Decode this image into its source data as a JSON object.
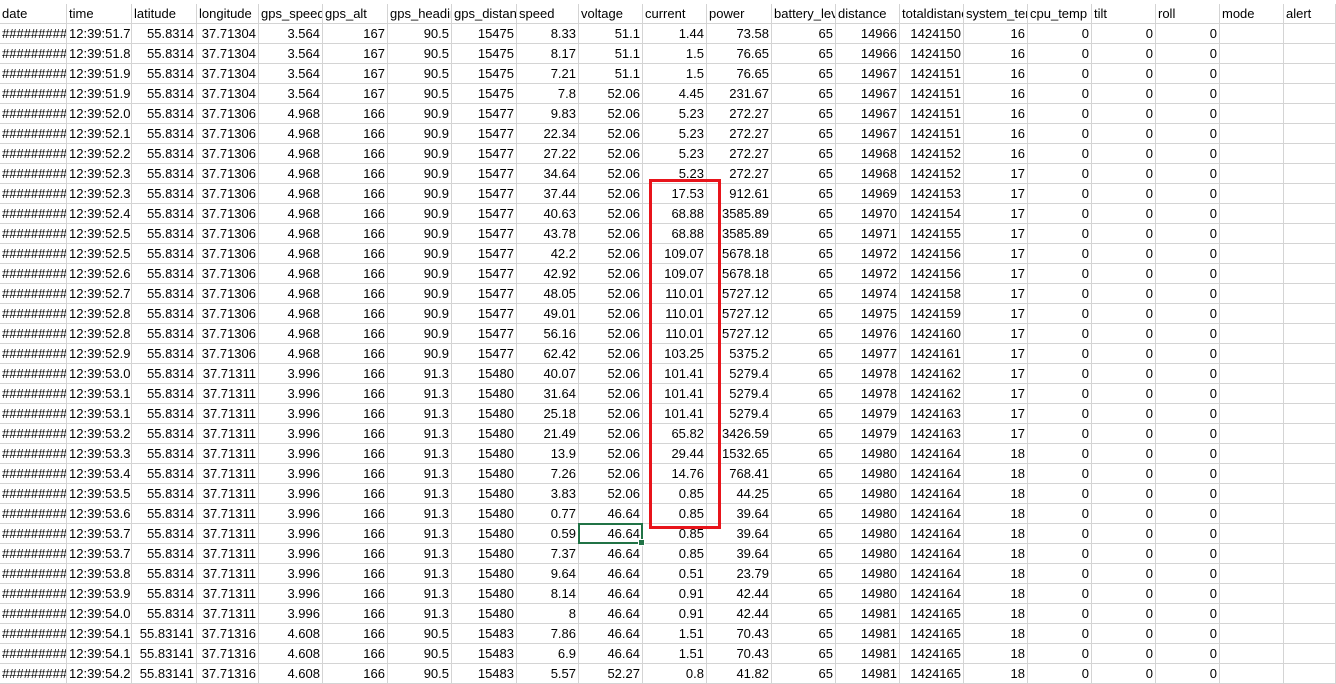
{
  "sheet": {
    "headers": [
      "date",
      "time",
      "latitude",
      "longitude",
      "gps_speed",
      "gps_alt",
      "gps_heading",
      "gps_distance",
      "speed",
      "voltage",
      "current",
      "power",
      "battery_level",
      "distance",
      "totaldistance",
      "system_temp",
      "cpu_temp",
      "tilt",
      "roll",
      "mode",
      "alert"
    ],
    "header_display": [
      "date",
      "time",
      "latitude",
      "longitude",
      "gps_speed",
      "gps_alt",
      "gps_heading",
      "gps_distance",
      "speed",
      "voltage",
      "current",
      "power",
      "battery_level",
      "distance",
      "totaldistance",
      "system_temp",
      "cpu_temp",
      "tilt",
      "roll",
      "mode",
      "alert"
    ],
    "rows": [
      [
        "#########",
        "12:39:51.7",
        "55.8314",
        "37.71304",
        "3.564",
        "167",
        "90.5",
        "15475",
        "8.33",
        "51.1",
        "1.44",
        "73.58",
        "65",
        "14966",
        "1424150",
        "16",
        "0",
        "0",
        "0",
        "",
        ""
      ],
      [
        "#########",
        "12:39:51.8",
        "55.8314",
        "37.71304",
        "3.564",
        "167",
        "90.5",
        "15475",
        "8.17",
        "51.1",
        "1.5",
        "76.65",
        "65",
        "14966",
        "1424150",
        "16",
        "0",
        "0",
        "0",
        "",
        ""
      ],
      [
        "#########",
        "12:39:51.9",
        "55.8314",
        "37.71304",
        "3.564",
        "167",
        "90.5",
        "15475",
        "7.21",
        "51.1",
        "1.5",
        "76.65",
        "65",
        "14967",
        "1424151",
        "16",
        "0",
        "0",
        "0",
        "",
        ""
      ],
      [
        "#########",
        "12:39:51.9",
        "55.8314",
        "37.71304",
        "3.564",
        "167",
        "90.5",
        "15475",
        "7.8",
        "52.06",
        "4.45",
        "231.67",
        "65",
        "14967",
        "1424151",
        "16",
        "0",
        "0",
        "0",
        "",
        ""
      ],
      [
        "#########",
        "12:39:52.0",
        "55.8314",
        "37.71306",
        "4.968",
        "166",
        "90.9",
        "15477",
        "9.83",
        "52.06",
        "5.23",
        "272.27",
        "65",
        "14967",
        "1424151",
        "16",
        "0",
        "0",
        "0",
        "",
        ""
      ],
      [
        "#########",
        "12:39:52.1",
        "55.8314",
        "37.71306",
        "4.968",
        "166",
        "90.9",
        "15477",
        "22.34",
        "52.06",
        "5.23",
        "272.27",
        "65",
        "14967",
        "1424151",
        "16",
        "0",
        "0",
        "0",
        "",
        ""
      ],
      [
        "#########",
        "12:39:52.2",
        "55.8314",
        "37.71306",
        "4.968",
        "166",
        "90.9",
        "15477",
        "27.22",
        "52.06",
        "5.23",
        "272.27",
        "65",
        "14968",
        "1424152",
        "16",
        "0",
        "0",
        "0",
        "",
        ""
      ],
      [
        "#########",
        "12:39:52.3",
        "55.8314",
        "37.71306",
        "4.968",
        "166",
        "90.9",
        "15477",
        "34.64",
        "52.06",
        "5.23",
        "272.27",
        "65",
        "14968",
        "1424152",
        "17",
        "0",
        "0",
        "0",
        "",
        ""
      ],
      [
        "#########",
        "12:39:52.3",
        "55.8314",
        "37.71306",
        "4.968",
        "166",
        "90.9",
        "15477",
        "37.44",
        "52.06",
        "17.53",
        "912.61",
        "65",
        "14969",
        "1424153",
        "17",
        "0",
        "0",
        "0",
        "",
        ""
      ],
      [
        "#########",
        "12:39:52.4",
        "55.8314",
        "37.71306",
        "4.968",
        "166",
        "90.9",
        "15477",
        "40.63",
        "52.06",
        "68.88",
        "3585.89",
        "65",
        "14970",
        "1424154",
        "17",
        "0",
        "0",
        "0",
        "",
        ""
      ],
      [
        "#########",
        "12:39:52.5",
        "55.8314",
        "37.71306",
        "4.968",
        "166",
        "90.9",
        "15477",
        "43.78",
        "52.06",
        "68.88",
        "3585.89",
        "65",
        "14971",
        "1424155",
        "17",
        "0",
        "0",
        "0",
        "",
        ""
      ],
      [
        "#########",
        "12:39:52.5",
        "55.8314",
        "37.71306",
        "4.968",
        "166",
        "90.9",
        "15477",
        "42.2",
        "52.06",
        "109.07",
        "5678.18",
        "65",
        "14972",
        "1424156",
        "17",
        "0",
        "0",
        "0",
        "",
        ""
      ],
      [
        "#########",
        "12:39:52.6",
        "55.8314",
        "37.71306",
        "4.968",
        "166",
        "90.9",
        "15477",
        "42.92",
        "52.06",
        "109.07",
        "5678.18",
        "65",
        "14972",
        "1424156",
        "17",
        "0",
        "0",
        "0",
        "",
        ""
      ],
      [
        "#########",
        "12:39:52.7",
        "55.8314",
        "37.71306",
        "4.968",
        "166",
        "90.9",
        "15477",
        "48.05",
        "52.06",
        "110.01",
        "5727.12",
        "65",
        "14974",
        "1424158",
        "17",
        "0",
        "0",
        "0",
        "",
        ""
      ],
      [
        "#########",
        "12:39:52.8",
        "55.8314",
        "37.71306",
        "4.968",
        "166",
        "90.9",
        "15477",
        "49.01",
        "52.06",
        "110.01",
        "5727.12",
        "65",
        "14975",
        "1424159",
        "17",
        "0",
        "0",
        "0",
        "",
        ""
      ],
      [
        "#########",
        "12:39:52.8",
        "55.8314",
        "37.71306",
        "4.968",
        "166",
        "90.9",
        "15477",
        "56.16",
        "52.06",
        "110.01",
        "5727.12",
        "65",
        "14976",
        "1424160",
        "17",
        "0",
        "0",
        "0",
        "",
        ""
      ],
      [
        "#########",
        "12:39:52.9",
        "55.8314",
        "37.71306",
        "4.968",
        "166",
        "90.9",
        "15477",
        "62.42",
        "52.06",
        "103.25",
        "5375.2",
        "65",
        "14977",
        "1424161",
        "17",
        "0",
        "0",
        "0",
        "",
        ""
      ],
      [
        "#########",
        "12:39:53.0",
        "55.8314",
        "37.71311",
        "3.996",
        "166",
        "91.3",
        "15480",
        "40.07",
        "52.06",
        "101.41",
        "5279.4",
        "65",
        "14978",
        "1424162",
        "17",
        "0",
        "0",
        "0",
        "",
        ""
      ],
      [
        "#########",
        "12:39:53.1",
        "55.8314",
        "37.71311",
        "3.996",
        "166",
        "91.3",
        "15480",
        "31.64",
        "52.06",
        "101.41",
        "5279.4",
        "65",
        "14978",
        "1424162",
        "17",
        "0",
        "0",
        "0",
        "",
        ""
      ],
      [
        "#########",
        "12:39:53.1",
        "55.8314",
        "37.71311",
        "3.996",
        "166",
        "91.3",
        "15480",
        "25.18",
        "52.06",
        "101.41",
        "5279.4",
        "65",
        "14979",
        "1424163",
        "17",
        "0",
        "0",
        "0",
        "",
        ""
      ],
      [
        "#########",
        "12:39:53.2",
        "55.8314",
        "37.71311",
        "3.996",
        "166",
        "91.3",
        "15480",
        "21.49",
        "52.06",
        "65.82",
        "3426.59",
        "65",
        "14979",
        "1424163",
        "17",
        "0",
        "0",
        "0",
        "",
        ""
      ],
      [
        "#########",
        "12:39:53.3",
        "55.8314",
        "37.71311",
        "3.996",
        "166",
        "91.3",
        "15480",
        "13.9",
        "52.06",
        "29.44",
        "1532.65",
        "65",
        "14980",
        "1424164",
        "18",
        "0",
        "0",
        "0",
        "",
        ""
      ],
      [
        "#########",
        "12:39:53.4",
        "55.8314",
        "37.71311",
        "3.996",
        "166",
        "91.3",
        "15480",
        "7.26",
        "52.06",
        "14.76",
        "768.41",
        "65",
        "14980",
        "1424164",
        "18",
        "0",
        "0",
        "0",
        "",
        ""
      ],
      [
        "#########",
        "12:39:53.5",
        "55.8314",
        "37.71311",
        "3.996",
        "166",
        "91.3",
        "15480",
        "3.83",
        "52.06",
        "0.85",
        "44.25",
        "65",
        "14980",
        "1424164",
        "18",
        "0",
        "0",
        "0",
        "",
        ""
      ],
      [
        "#########",
        "12:39:53.6",
        "55.8314",
        "37.71311",
        "3.996",
        "166",
        "91.3",
        "15480",
        "0.77",
        "46.64",
        "0.85",
        "39.64",
        "65",
        "14980",
        "1424164",
        "18",
        "0",
        "0",
        "0",
        "",
        ""
      ],
      [
        "#########",
        "12:39:53.7",
        "55.8314",
        "37.71311",
        "3.996",
        "166",
        "91.3",
        "15480",
        "0.59",
        "46.64",
        "0.85",
        "39.64",
        "65",
        "14980",
        "1424164",
        "18",
        "0",
        "0",
        "0",
        "",
        ""
      ],
      [
        "#########",
        "12:39:53.7",
        "55.8314",
        "37.71311",
        "3.996",
        "166",
        "91.3",
        "15480",
        "7.37",
        "46.64",
        "0.85",
        "39.64",
        "65",
        "14980",
        "1424164",
        "18",
        "0",
        "0",
        "0",
        "",
        ""
      ],
      [
        "#########",
        "12:39:53.8",
        "55.8314",
        "37.71311",
        "3.996",
        "166",
        "91.3",
        "15480",
        "9.64",
        "46.64",
        "0.51",
        "23.79",
        "65",
        "14980",
        "1424164",
        "18",
        "0",
        "0",
        "0",
        "",
        ""
      ],
      [
        "#########",
        "12:39:53.9",
        "55.8314",
        "37.71311",
        "3.996",
        "166",
        "91.3",
        "15480",
        "8.14",
        "46.64",
        "0.91",
        "42.44",
        "65",
        "14980",
        "1424164",
        "18",
        "0",
        "0",
        "0",
        "",
        ""
      ],
      [
        "#########",
        "12:39:54.0",
        "55.8314",
        "37.71311",
        "3.996",
        "166",
        "91.3",
        "15480",
        "8",
        "46.64",
        "0.91",
        "42.44",
        "65",
        "14981",
        "1424165",
        "18",
        "0",
        "0",
        "0",
        "",
        ""
      ],
      [
        "#########",
        "12:39:54.1",
        "55.83141",
        "37.71316",
        "4.608",
        "166",
        "90.5",
        "15483",
        "7.86",
        "46.64",
        "1.51",
        "70.43",
        "65",
        "14981",
        "1424165",
        "18",
        "0",
        "0",
        "0",
        "",
        ""
      ],
      [
        "#########",
        "12:39:54.1",
        "55.83141",
        "37.71316",
        "4.608",
        "166",
        "90.5",
        "15483",
        "6.9",
        "46.64",
        "1.51",
        "70.43",
        "65",
        "14981",
        "1424165",
        "18",
        "0",
        "0",
        "0",
        "",
        ""
      ],
      [
        "#########",
        "12:39:54.2",
        "55.83141",
        "37.71316",
        "4.608",
        "166",
        "90.5",
        "15483",
        "5.57",
        "52.27",
        "0.8",
        "41.82",
        "65",
        "14981",
        "1424165",
        "18",
        "0",
        "0",
        "0",
        "",
        ""
      ]
    ],
    "active_cell": {
      "row": 25,
      "col": 9
    },
    "highlight": {
      "col": 10,
      "row_start": 8,
      "row_end": 24
    },
    "colors": {
      "gridline": "#d4d4d4",
      "active_cell_border": "#217346",
      "highlight_border": "#e8141b"
    }
  }
}
